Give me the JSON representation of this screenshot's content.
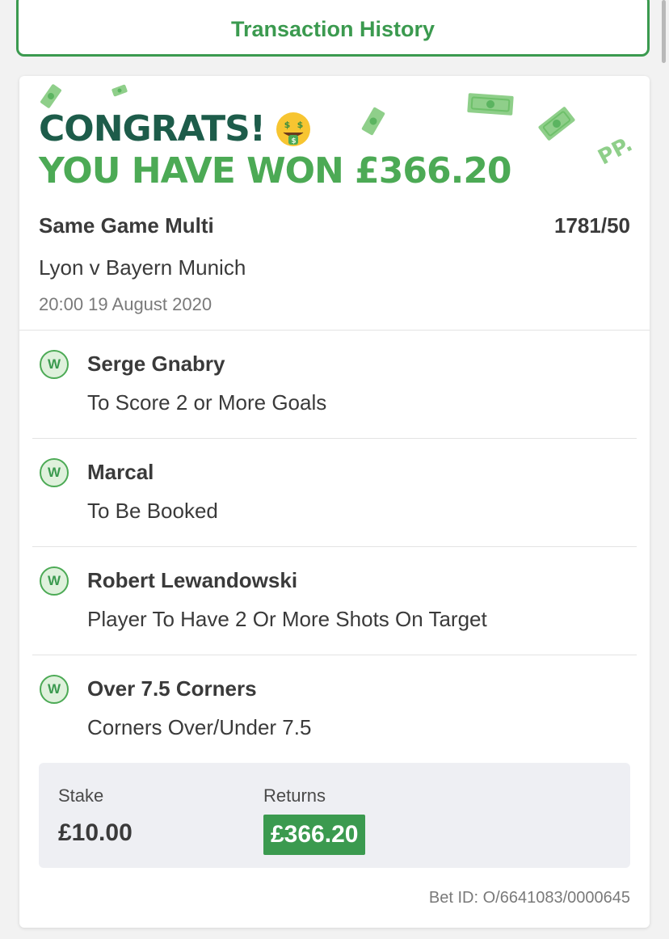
{
  "header": {
    "transaction_history_label": "Transaction History"
  },
  "banner": {
    "congrats_text": "CONGRATS!",
    "won_text": "YOU HAVE WON £366.20",
    "emoji": "money-mouth-face",
    "brand_logo": "PP."
  },
  "bet": {
    "type": "Same Game Multi",
    "odds": "1781/50",
    "event": "Lyon v Bayern Munich",
    "datetime": "20:00 19 August 2020"
  },
  "selections": [
    {
      "result": "W",
      "title": "Serge Gnabry",
      "market": "To Score 2 or More Goals"
    },
    {
      "result": "W",
      "title": "Marcal",
      "market": "To Be Booked"
    },
    {
      "result": "W",
      "title": "Robert Lewandowski",
      "market": "Player To Have 2 Or More Shots On Target"
    },
    {
      "result": "W",
      "title": "Over 7.5 Corners",
      "market": "Corners Over/Under 7.5"
    }
  ],
  "summary": {
    "stake_label": "Stake",
    "stake_value": "£10.00",
    "returns_label": "Returns",
    "returns_value": "£366.20"
  },
  "footer": {
    "bet_id": "Bet ID: O/6641083/0000645"
  },
  "colors": {
    "brand_green": "#3b9a4f",
    "dark_green": "#1d5c4a",
    "light_green": "#4caa55",
    "summary_bg": "#eeeff3"
  }
}
